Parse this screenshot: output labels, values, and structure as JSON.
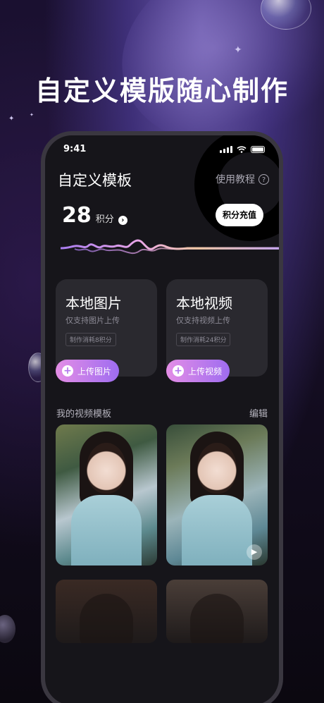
{
  "promo": {
    "headline": "自定义模版随心制作"
  },
  "status_bar": {
    "time": "9:41"
  },
  "header": {
    "title": "自定义模板",
    "help_label": "使用教程",
    "help_icon": "question-icon"
  },
  "points": {
    "value": "28",
    "unit": "积分",
    "recharge_label": "积分充值"
  },
  "cards": {
    "image": {
      "title": "本地图片",
      "subtitle": "仅支持图片上传",
      "cost": "制作消耗8积分",
      "button": "上传图片"
    },
    "video": {
      "title": "本地视频",
      "subtitle": "仅支持视频上传",
      "cost": "制作消耗24积分",
      "button": "上传视频"
    }
  },
  "templates": {
    "section_title": "我的视频模板",
    "edit_label": "编辑"
  },
  "colors": {
    "accent_gradient_start": "#e48ee6",
    "accent_gradient_end": "#9e6cf0",
    "screen_bg": "#16151a",
    "card_bg": "#2a292f"
  }
}
